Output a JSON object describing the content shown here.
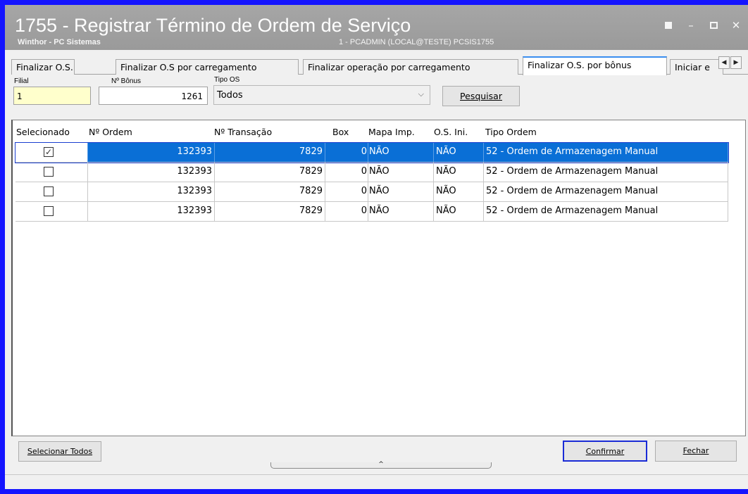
{
  "window": {
    "title": "1755 - Registrar Término de Ordem de Serviço",
    "subtitle": "Winthor - PC Sistemas",
    "conninfo": "1 - PCADMIN (LOCAL@TESTE)   PCSIS1755",
    "accent_color": "#1414ff",
    "titlebar_color": "#9e9e9e"
  },
  "tabs": [
    {
      "label": "Finalizar O.S."
    },
    {
      "label": "Finalizar O.S por carregamento"
    },
    {
      "label": "Finalizar operação por carregamento"
    },
    {
      "label": "Finalizar O.S. por bônus",
      "active": true
    },
    {
      "label": "Iniciar e"
    }
  ],
  "filters": {
    "filial_label": "Filial",
    "filial_value": "1",
    "bonus_label": "Nº Bônus",
    "bonus_value": "1261",
    "tipo_label": "Tipo OS",
    "tipo_value": "Todos",
    "search_button": "Pesquisar"
  },
  "grid": {
    "columns": [
      "Selecionado",
      "Nº Ordem",
      "Nº Transação",
      "Box",
      "Mapa Imp.",
      "O.S. Ini.",
      "Tipo Ordem"
    ],
    "rows": [
      {
        "selected": true,
        "ordem": "132393",
        "transacao": "7829",
        "box": "0",
        "mapa": "NÃO",
        "osini": "NÃO",
        "tipo": "52 - Ordem de Armazenagem Manual"
      },
      {
        "selected": false,
        "ordem": "132393",
        "transacao": "7829",
        "box": "0",
        "mapa": "NÃO",
        "osini": "NÃO",
        "tipo": "52 - Ordem de Armazenagem Manual"
      },
      {
        "selected": false,
        "ordem": "132393",
        "transacao": "7829",
        "box": "0",
        "mapa": "NÃO",
        "osini": "NÃO",
        "tipo": "52 - Ordem de Armazenagem Manual"
      },
      {
        "selected": false,
        "ordem": "132393",
        "transacao": "7829",
        "box": "0",
        "mapa": "NÃO",
        "osini": "NÃO",
        "tipo": "52 - Ordem de Armazenagem Manual"
      }
    ],
    "selection_color": "#0a6fd6"
  },
  "footer": {
    "select_all": "Selecionar Todos",
    "confirm": "Confirmar",
    "close": "Fechar"
  },
  "icons": {
    "checkmark": "✓",
    "chevron_down": "⌵",
    "scroll_left": "◀",
    "scroll_right": "▶",
    "caret_up": "^"
  }
}
